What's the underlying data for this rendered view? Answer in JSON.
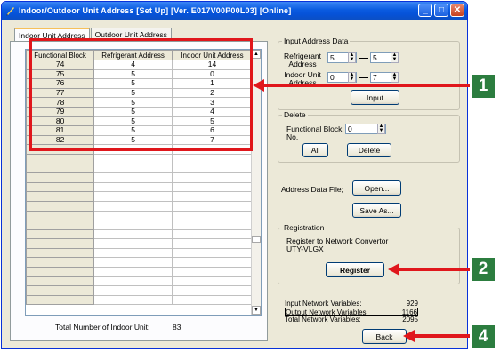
{
  "window": {
    "title": "Indoor/Outdoor Unit Address   [Set Up] [Ver. E017V00P00L03] [Online]",
    "controls": [
      "minimize-icon",
      "maximize-icon",
      "close-icon"
    ]
  },
  "tabs": [
    {
      "label": "Indoor Unit Address",
      "active": true
    },
    {
      "label": "Outdoor Unit Address",
      "active": false
    }
  ],
  "grid": {
    "columns": [
      "Functional Block",
      "Refrigerant Address",
      "Indoor Unit Address"
    ],
    "rows": [
      [
        "74",
        "4",
        "14"
      ],
      [
        "75",
        "5",
        "0"
      ],
      [
        "76",
        "5",
        "1"
      ],
      [
        "77",
        "5",
        "2"
      ],
      [
        "78",
        "5",
        "3"
      ],
      [
        "79",
        "5",
        "4"
      ],
      [
        "80",
        "5",
        "5"
      ],
      [
        "81",
        "5",
        "6"
      ],
      [
        "82",
        "5",
        "7"
      ]
    ],
    "empty_rows": 17
  },
  "total": {
    "label": "Total Number of Indoor Unit:",
    "value": "83"
  },
  "input_address": {
    "group_label": "Input Address Data",
    "refrigerant_label": "Refrigerant Address",
    "refrigerant_from": "5",
    "refrigerant_to": "5",
    "indoor_label": "Indoor Unit Address",
    "indoor_from": "0",
    "indoor_to": "7",
    "input_button": "Input"
  },
  "delete": {
    "group_label": "Delete",
    "block_label": "Functional Block No.",
    "block_value": "0",
    "all_button": "All",
    "delete_button": "Delete"
  },
  "address_file": {
    "label": "Address Data File;",
    "open_button": "Open...",
    "save_button": "Save As..."
  },
  "registration": {
    "group_label": "Registration",
    "text": "Register to Network Convertor UTY-VLGX",
    "register_button": "Register"
  },
  "net_vars": [
    {
      "label": "Input Network Variables:",
      "value": "929"
    },
    {
      "label": "Output Network Variables:",
      "value": "1166"
    },
    {
      "label": "Total Network Variables:",
      "value": "2095"
    }
  ],
  "back_button": "Back",
  "callouts": [
    "1",
    "2",
    "4"
  ],
  "colors": {
    "callout_red": "#e0171c",
    "badge_green": "#2c7d3f",
    "title_blue": "#0a5be0"
  }
}
